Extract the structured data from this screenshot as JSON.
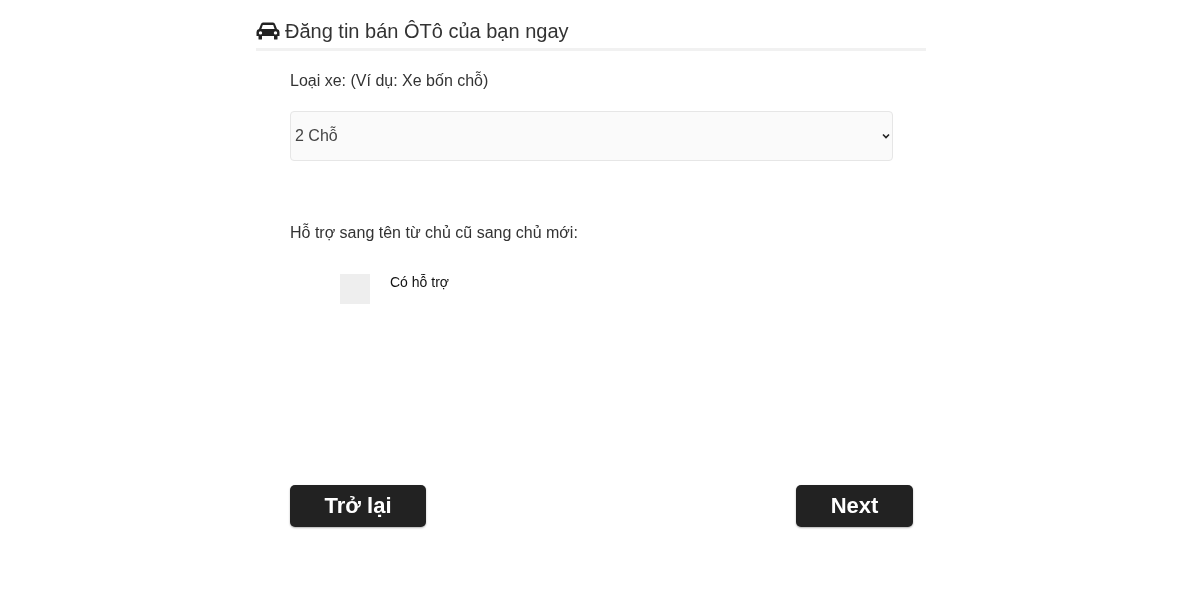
{
  "heading": {
    "title": "Đăng tin bán ÔTô của bạn ngay"
  },
  "car_type": {
    "label": "Loại xe: (Ví dụ: Xe bốn chỗ)",
    "value": "2 Chỗ"
  },
  "transfer_support": {
    "label": "Hỗ trợ sang tên từ chủ cũ sang chủ mới:",
    "option": {
      "label": "Có hỗ trợ",
      "checked": false
    }
  },
  "buttons": {
    "back": "Trở lại",
    "next": "Next"
  }
}
